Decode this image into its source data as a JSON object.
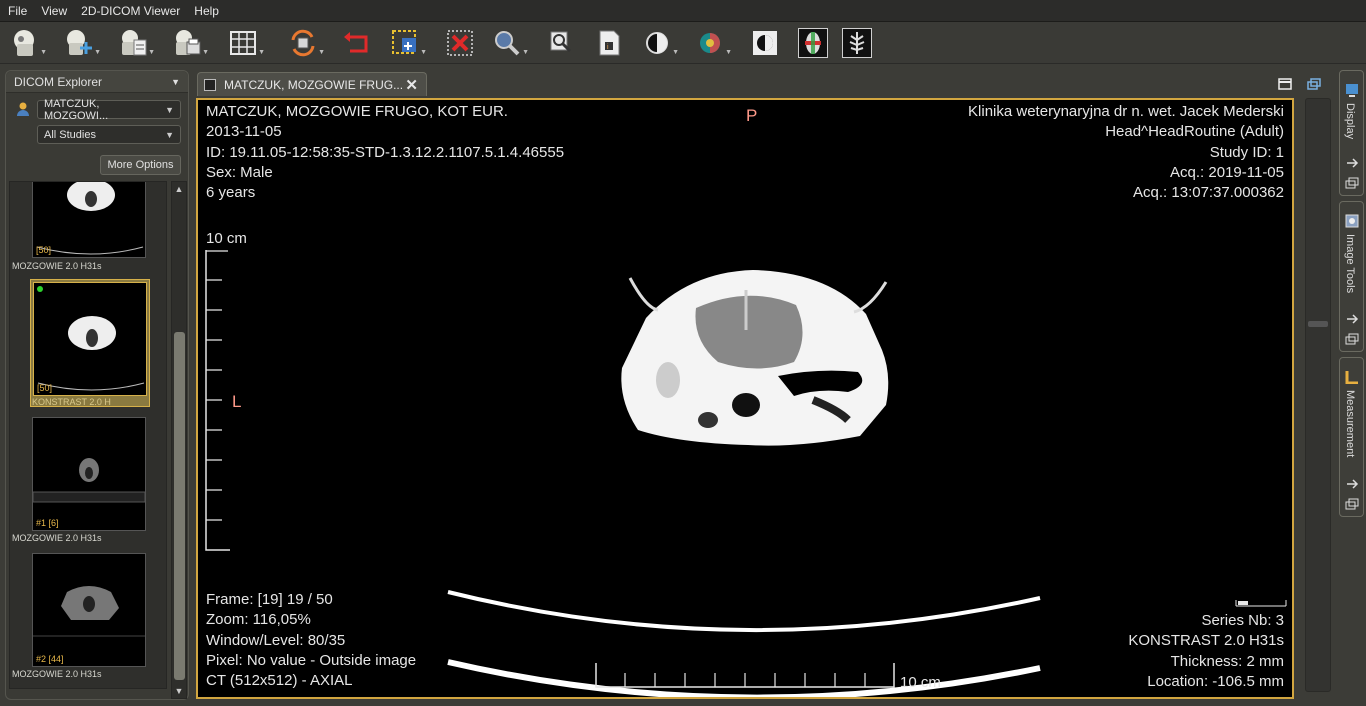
{
  "menu": [
    "File",
    "View",
    "2D-DICOM Viewer",
    "Help"
  ],
  "toolbar": {
    "buttons": [
      "open-dicom-icon",
      "import-icon",
      "export-icon",
      "print-icon",
      "layout-grid-icon",
      "sync-icon",
      "rotate-icon",
      "roi-select-icon",
      "delete-icon",
      "zoom-icon",
      "magnifier-icon",
      "info-icon",
      "window-level-icon",
      "lut-icon",
      "invert-icon",
      "mpr-icon",
      "mip-icon"
    ]
  },
  "explorer": {
    "title": "DICOM Explorer",
    "patient_select": "MATCZUK, MOZGOWI...",
    "study_select": "All Studies",
    "more_options": "More Options",
    "thumbnails": [
      {
        "index": "[50]",
        "label": "MOZGOWIE  2.0  H31s"
      },
      {
        "index": "[50]",
        "label": "KONSTRAST  2.0  H"
      },
      {
        "index": "#1 [6]",
        "label": "MOZGOWIE  2.0  H31s"
      },
      {
        "index": "#2 [44]",
        "label": "MOZGOWIE  2.0  H31s"
      }
    ]
  },
  "tab": {
    "title": "MATCZUK, MOZGOWIE FRUG..."
  },
  "viewer": {
    "top_left": [
      "MATCZUK, MOZGOWIE FRUGO, KOT EUR.",
      "2013-11-05",
      "ID: 19.11.05-12:58:35-STD-1.3.12.2.1107.5.1.4.46555",
      "Sex: Male",
      "6 years"
    ],
    "top_right": [
      "Klinika weterynaryjna dr n. wet. Jacek Mederski",
      "Head^HeadRoutine (Adult)",
      "Study ID: 1",
      "Acq.: 2019-11-05",
      "Acq.: 13:07:37.000362"
    ],
    "bottom_left": [
      "Frame: [19] 19 / 50",
      "Zoom: 116,05%",
      "Window/Level: 80/35",
      "Pixel: No value - Outside image",
      "CT (512x512) - AXIAL"
    ],
    "bottom_right": [
      "Series Nb: 3",
      "KONSTRAST  2.0  H31s",
      "Thickness: 2 mm",
      "Location: -106.5 mm"
    ],
    "orientation_top": "P",
    "orientation_left": "L",
    "ruler_vertical_label": "10 cm",
    "ruler_horizontal_label": "10 cm"
  },
  "side_tabs": [
    "Display",
    "Image Tools",
    "Measurement"
  ],
  "colors": {
    "viewer_border": "#d2a640",
    "overlay_text": "#e6e6e6",
    "orientation": "#ff9a8a",
    "thumb_index": "#e8b84a",
    "selected_thumb": "#8a7a40"
  }
}
